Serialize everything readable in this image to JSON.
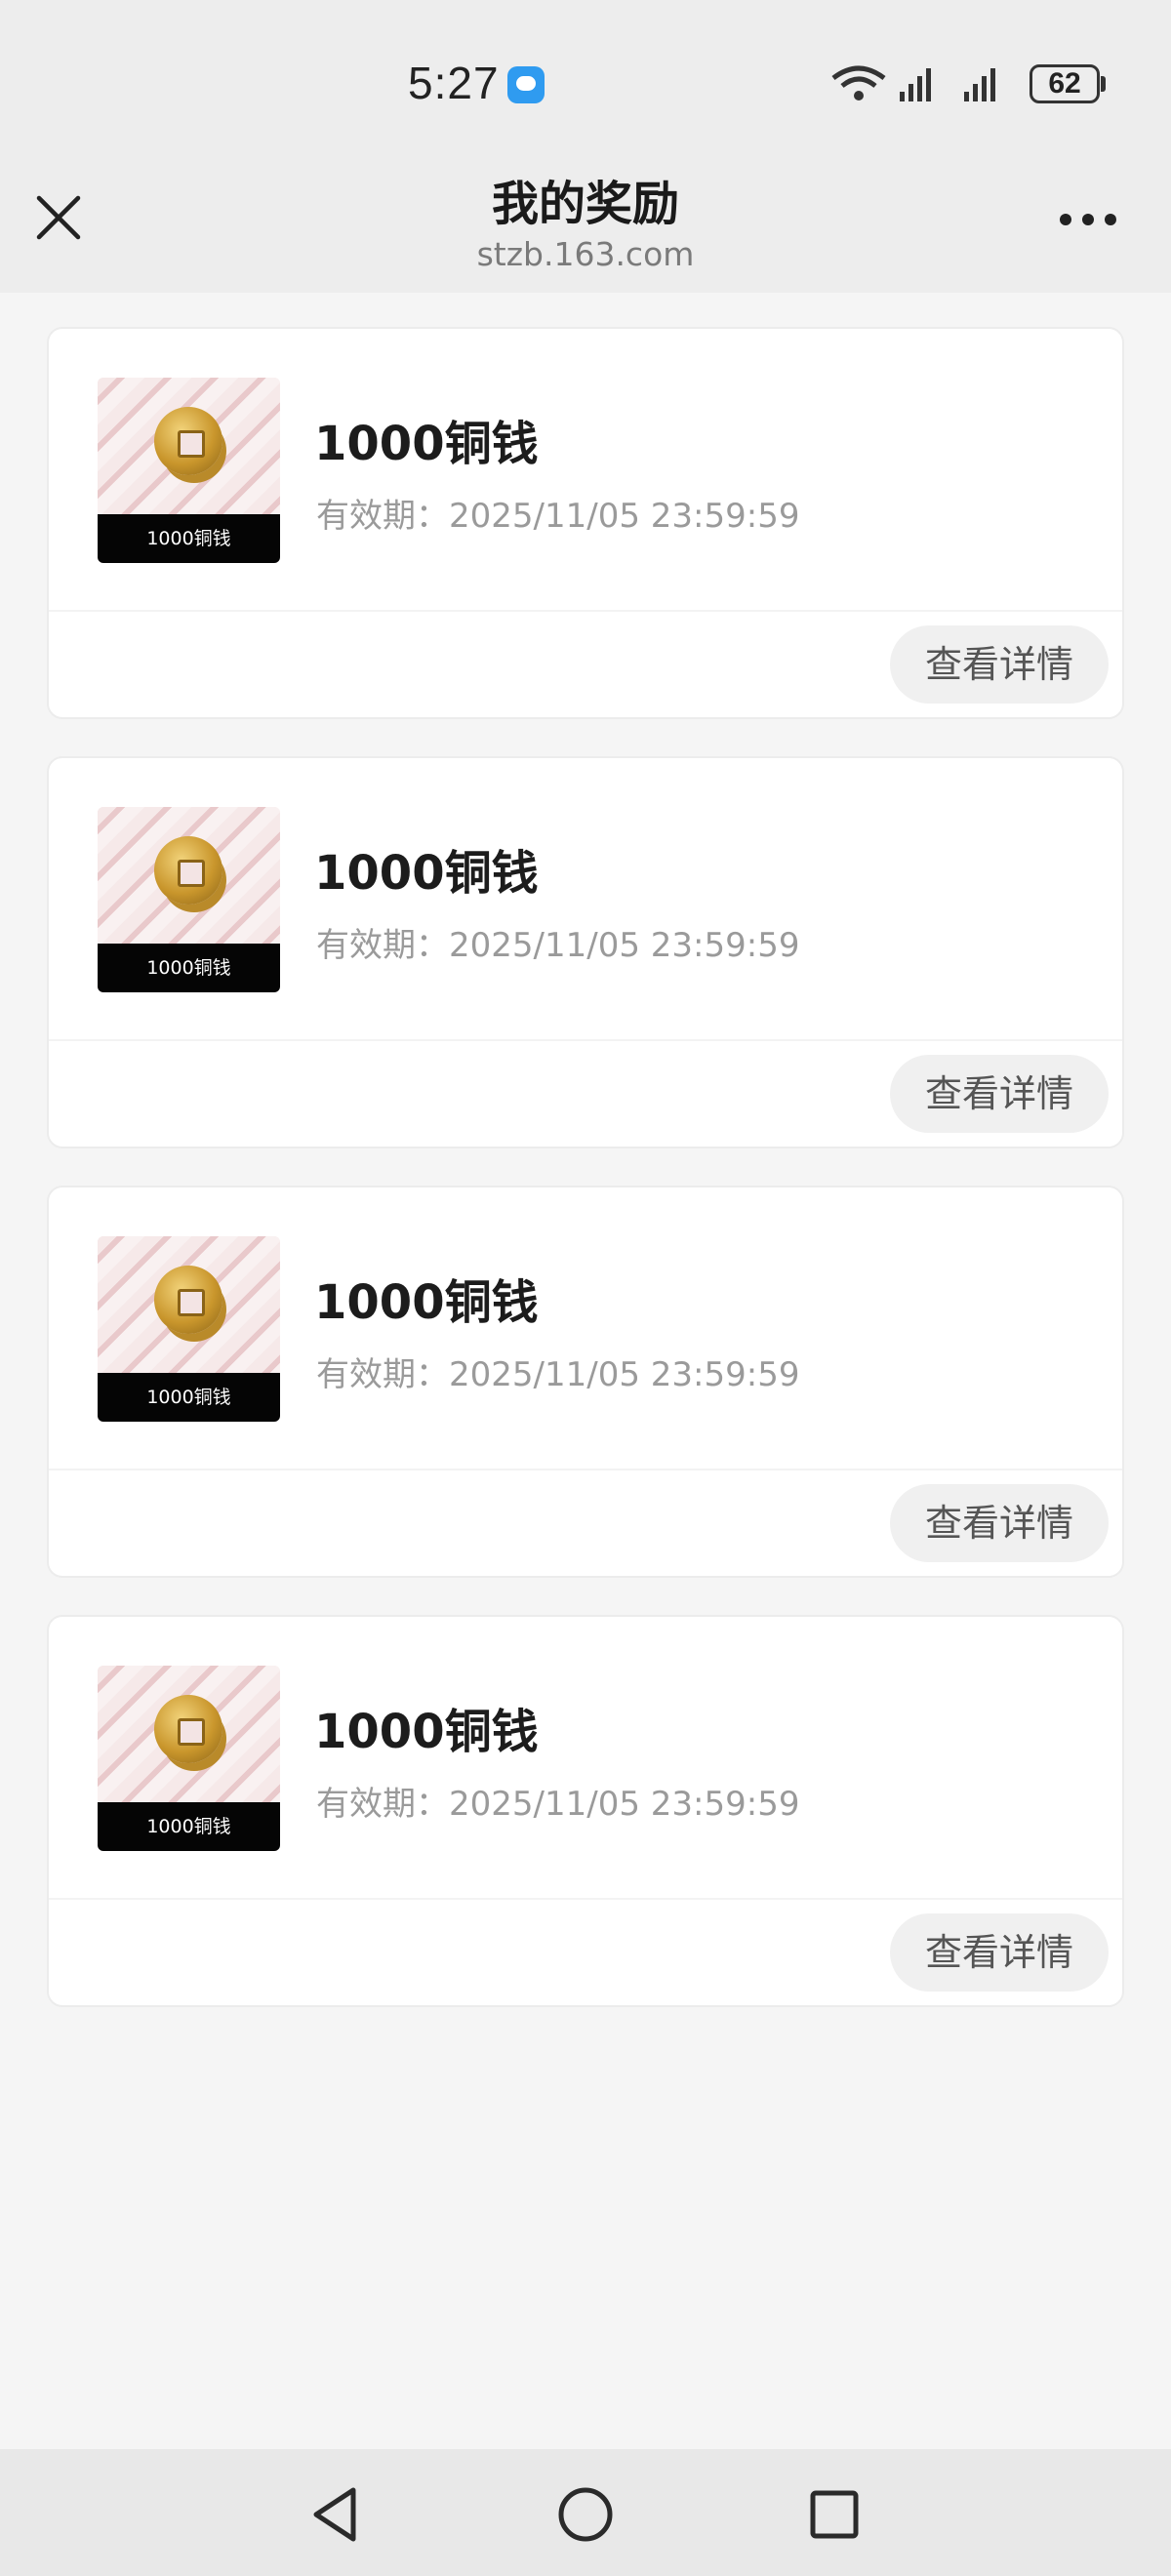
{
  "status_bar": {
    "time": "5:27",
    "battery": "62",
    "icons": [
      "message-icon",
      "wifi-icon",
      "signal-4g-icon",
      "signal-5g-icon",
      "battery-icon"
    ]
  },
  "header": {
    "title": "我的奖励",
    "subtitle": "stzb.163.com",
    "close_icon": "close-icon",
    "more_icon": "more-icon"
  },
  "rewards": [
    {
      "thumb_label": "1000铜钱",
      "title": "1000铜钱",
      "expiry": "有效期：2025/11/05 23:59:59",
      "button": "查看详情"
    },
    {
      "thumb_label": "1000铜钱",
      "title": "1000铜钱",
      "expiry": "有效期：2025/11/05 23:59:59",
      "button": "查看详情"
    },
    {
      "thumb_label": "1000铜钱",
      "title": "1000铜钱",
      "expiry": "有效期：2025/11/05 23:59:59",
      "button": "查看详情"
    },
    {
      "thumb_label": "1000铜钱",
      "title": "1000铜钱",
      "expiry": "有效期：2025/11/05 23:59:59",
      "button": "查看详情"
    }
  ],
  "bottom_nav": [
    "back-icon",
    "home-icon",
    "recents-icon"
  ]
}
